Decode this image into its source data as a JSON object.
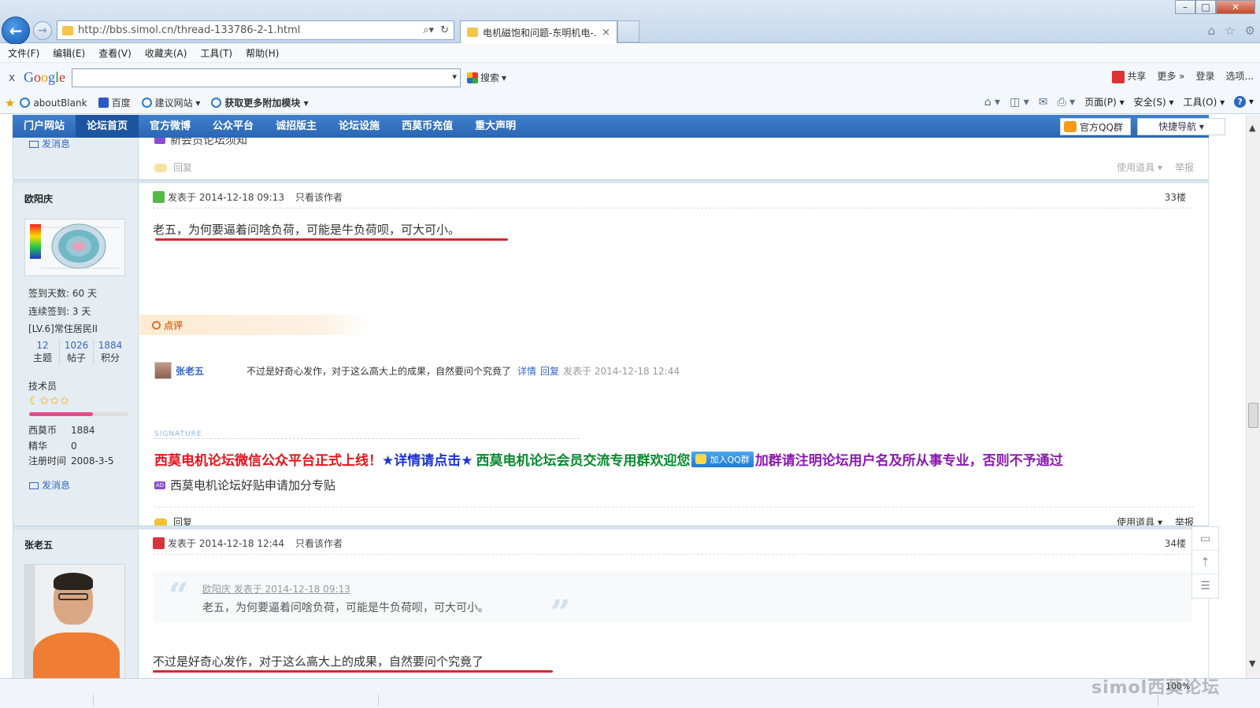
{
  "browser": {
    "url": "http://bbs.simol.cn/thread-133786-2-1.html",
    "tab_title": "电机磁饱和问题-东明机电-...",
    "tab_close": "×",
    "menu": [
      "文件(F)",
      "编辑(E)",
      "查看(V)",
      "收藏夹(A)",
      "工具(T)",
      "帮助(H)"
    ],
    "google_toolbar": {
      "close": "x",
      "search_label": "搜索",
      "share": "共享",
      "more": "更多 »",
      "login": "登录",
      "options": "选项..."
    },
    "favorites": {
      "items": [
        "aboutBlank",
        "百度",
        "建议网站 ▾",
        "获取更多附加模块 ▾"
      ]
    },
    "command_bar": [
      "页面(P) ▾",
      "安全(S) ▾",
      "工具(O) ▾"
    ],
    "zoom": "100%"
  },
  "forum_nav": {
    "items": [
      "门户网站",
      "论坛首页",
      "官方微博",
      "公众平台",
      "诚招版主",
      "论坛设施",
      "西莫币充值",
      "重大声明"
    ],
    "active_index": 1,
    "qq_group": "官方QQ群",
    "quick_nav": "快捷导航 ▾"
  },
  "prev_post": {
    "send_msg": "发消息",
    "sig_line": "新会员论坛须知",
    "reply": "回复",
    "tools": "使用道具 ▾",
    "report": "举报"
  },
  "post33": {
    "author": "欧阳庆",
    "posted_at": "发表于 2014-12-18 09:13",
    "only_author": "只看该作者",
    "floor": "33楼",
    "content": "老五，为何要逼着问啥负荷，可能是牛负荷呗，可大可小。",
    "user_stats": [
      "签到天数: 60 天",
      "连续签到: 3 天",
      "[LV.6]常住居民II"
    ],
    "counts": [
      {
        "num": "12",
        "label": "主题"
      },
      {
        "num": "1026",
        "label": "帖子"
      },
      {
        "num": "1884",
        "label": "积分"
      }
    ],
    "rank": "技术员",
    "rank_stars": "☾✩✩✩",
    "rank_progress": 0.64,
    "extra": [
      {
        "k": "西莫币",
        "v": "1884"
      },
      {
        "k": "精华",
        "v": "0"
      },
      {
        "k": "注册时间",
        "v": "2008-3-5"
      }
    ],
    "send_msg": "发消息",
    "comment_tab": "点评",
    "comment": {
      "user": "张老五",
      "text": "不过是好奇心发作，对于这么高大上的成果，自然要问个究竟了",
      "detail": "详情",
      "reply": "回复",
      "time": "发表于 2014-12-18 12:44"
    },
    "signature_label": "SIGNATURE",
    "signature": {
      "red": "西莫电机论坛微信公众平台正式上线！",
      "blue": "★详情请点击★",
      "green": "西莫电机论坛会员交流专用群欢迎您",
      "qq_button": "加入QQ群",
      "purple": "加群请注明论坛用户名及所从事专业，否则不予通过"
    },
    "ad_badge": "AD",
    "ad_text": "西莫电机论坛好贴申请加分专贴",
    "reply": "回复",
    "tools": "使用道具 ▾",
    "report": "举报"
  },
  "post34": {
    "author": "张老五",
    "posted_at": "发表于 2014-12-18 12:44",
    "only_author": "只看该作者",
    "floor": "34楼",
    "quote_meta": "欧阳庆 发表于 2014-12-18 09:13",
    "quote_text": "老五，为何要逼着问啥负荷，可能是牛负荷呗，可大可小。",
    "content": "不过是好奇心发作，对于这么高大上的成果，自然要问个究竟了"
  },
  "watermark": "simol西莫论坛",
  "colors": {
    "nav_blue": "#2b66b3",
    "underline_red": "#d4282d",
    "link_blue": "#3366cc"
  }
}
